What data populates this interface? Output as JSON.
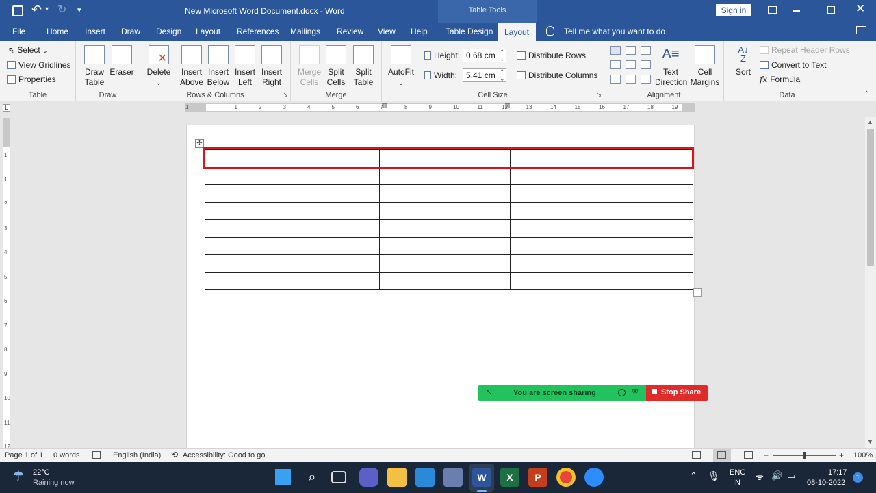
{
  "window": {
    "title": "New Microsoft Word Document.docx  -  Word",
    "context_group": "Table Tools",
    "sign_in": "Sign in",
    "autosave": "⟲",
    "undo": "↶",
    "redo": "↻",
    "qat_more": "▾"
  },
  "tabs": [
    "File",
    "Home",
    "Insert",
    "Draw",
    "Design",
    "Layout",
    "References",
    "Mailings",
    "Review",
    "View",
    "Help",
    "Table Design",
    "Layout"
  ],
  "tell_me": "Tell me what you want to do",
  "ribbon": {
    "table": {
      "label": "Table",
      "select": "Select",
      "select_arrow": "⌄",
      "gridlines": "View Gridlines",
      "properties": "Properties"
    },
    "draw": {
      "label": "Draw",
      "draw_table": [
        "Draw",
        "Table"
      ],
      "eraser": "Eraser"
    },
    "rows_columns": {
      "label": "Rows & Columns",
      "delete": "Delete",
      "delete_arrow": "⌄",
      "insert_above": [
        "Insert",
        "Above"
      ],
      "insert_below": [
        "Insert",
        "Below"
      ],
      "insert_left": [
        "Insert",
        "Left"
      ],
      "insert_right": [
        "Insert",
        "Right"
      ]
    },
    "merge": {
      "label": "Merge",
      "merge_cells": [
        "Merge",
        "Cells"
      ],
      "split_cells": [
        "Split",
        "Cells"
      ],
      "split_table": [
        "Split",
        "Table"
      ]
    },
    "cell_size": {
      "label": "Cell Size",
      "autofit": "AutoFit",
      "autofit_arrow": "⌄",
      "height_label": "Height:",
      "height_value": "0.68 cm",
      "width_label": "Width:",
      "width_value": "5.41 cm",
      "distribute_rows": "Distribute Rows",
      "distribute_columns": "Distribute Columns"
    },
    "alignment": {
      "label": "Alignment",
      "text_direction": [
        "Text",
        "Direction"
      ],
      "cell_margins": [
        "Cell",
        "Margins"
      ]
    },
    "data": {
      "label": "Data",
      "sort": "Sort",
      "repeat_header": "Repeat Header Rows",
      "convert": "Convert to Text",
      "formula": "Formula",
      "fx": "fx"
    }
  },
  "ruler_numbers": [
    "1",
    "1",
    "2",
    "3",
    "4",
    "5",
    "6",
    "7",
    "8",
    "9",
    "10",
    "11",
    "12",
    "13",
    "14",
    "15",
    "16",
    "17",
    "18",
    "19"
  ],
  "vruler_numbers": [
    "1",
    "1",
    "2",
    "3",
    "4",
    "5",
    "6",
    "7",
    "8",
    "9",
    "10",
    "11",
    "12"
  ],
  "document": {
    "rows": 8,
    "columns": 3
  },
  "screen_share": {
    "status": "You are screen sharing",
    "stop": "Stop Share"
  },
  "statusbar": {
    "page": "Page 1 of 1",
    "words": "0 words",
    "language": "English (India)",
    "accessibility": "Accessibility: Good to go",
    "zoom": "100%"
  },
  "taskbar": {
    "temp": "22°C",
    "weather": "Raining now",
    "lang1": "ENG",
    "lang2": "IN",
    "time": "17:17",
    "date": "08-10-2022",
    "badge": "1"
  },
  "colors": {
    "word_blue": "#2b579a",
    "highlight": "#d7151d",
    "share_green": "#22c35e",
    "stop_red": "#e02b2b"
  }
}
